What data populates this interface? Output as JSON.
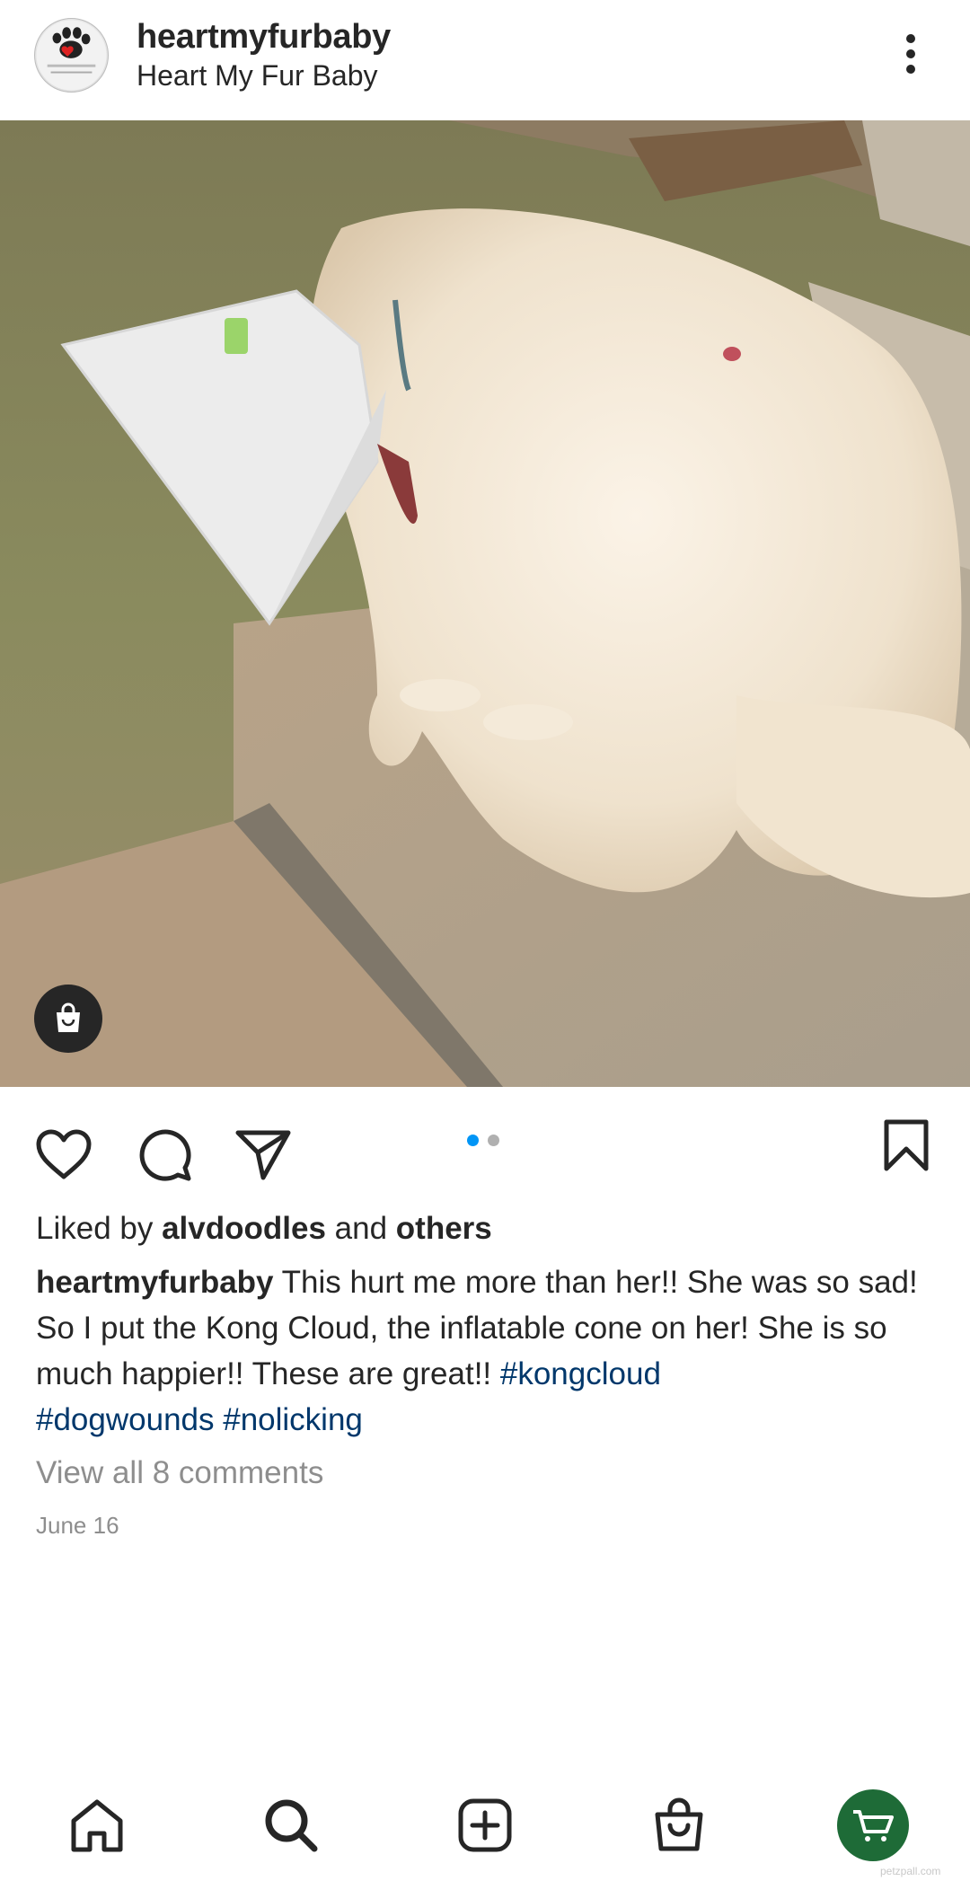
{
  "post": {
    "username": "heartmyfurbaby",
    "display_name": "Heart My Fur Baby",
    "liked_by_prefix": "Liked by ",
    "liked_by_user": "alvdoodles",
    "liked_by_conj": " and ",
    "liked_by_others": "others",
    "caption_user": "heartmyfurbaby",
    "caption_text": " This hurt me more than her!! She was so sad! So I put the Kong Cloud, the inflatable cone on her! She is so much happier!! These are great!! ",
    "hashtags": [
      "#kongcloud",
      "#dogwounds",
      "#nolicking"
    ],
    "view_comments": "View all 8 comments",
    "date": "June 16",
    "carousel_count": 2,
    "carousel_index": 1
  },
  "icons": {
    "more": "more-vertical-icon",
    "shopping_tag": "shopping-bag-icon",
    "like": "heart-outline-icon",
    "comment": "comment-icon",
    "share": "send-icon",
    "save": "bookmark-icon"
  },
  "bottom_nav": [
    {
      "name": "home",
      "icon": "home-icon"
    },
    {
      "name": "search",
      "icon": "search-icon"
    },
    {
      "name": "create",
      "icon": "add-post-icon"
    },
    {
      "name": "shop",
      "icon": "shopping-bag-icon"
    },
    {
      "name": "profile",
      "icon": "cart-avatar-icon"
    }
  ],
  "watermark": "petzpall.com",
  "colors": {
    "text": "#262626",
    "muted": "#8e8e8e",
    "hashtag": "#00376b",
    "carousel_active": "#0095f6",
    "profile_avatar_bg": "#1e6b37"
  }
}
